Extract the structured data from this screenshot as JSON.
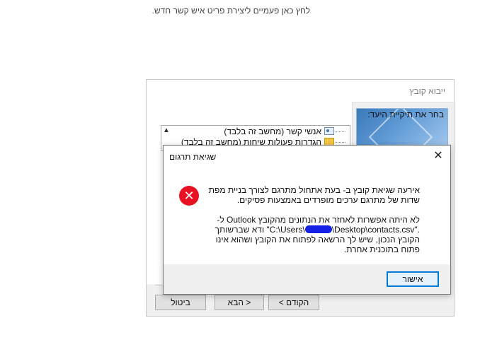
{
  "page": {
    "hint_text": "לחץ כאן פעמיים ליצירת פריט איש קשר חדש."
  },
  "wizard": {
    "title": "ייבוא קובץ",
    "folder_label": "בחר את תיקיית היעד:",
    "tree_items": [
      {
        "label": "אנשי קשר (מחשב זה בלבד)",
        "icon": "contacts-icon"
      },
      {
        "label": "הגדרות פעולות שיחות (מחשב זה בלבד)",
        "icon": "folder-icon"
      }
    ],
    "buttons": {
      "back": "< הקודם",
      "next": "הבא >",
      "cancel": "ביטול"
    }
  },
  "dialog": {
    "title": "שגיאת תרגום",
    "icon": "error-icon",
    "message_line1": "אירעה שגיאת קובץ ב- בעת אתחול מתרגם לצורך בניית מפת שדות של מתרגם ערכים מופרדים באמצעות פסיקים.",
    "message_line2_a": "לא היתה אפשרות לאחזר את הנתונים מהקובץ Outlook ל-",
    "path_start": "\"C:\\Users\\",
    "path_end": "\\Desktop\\contacts.csv\".",
    "message_line2_b": "ודא שברשותך הקובץ הנכון, שיש לך הרשאה לפתוח את הקובץ ושהוא אינו פתוח בתוכנית אחרת.",
    "ok_label": "אישור",
    "close_glyph": "✕"
  },
  "colors": {
    "error": "#e81123",
    "accent": "#0078d7"
  }
}
